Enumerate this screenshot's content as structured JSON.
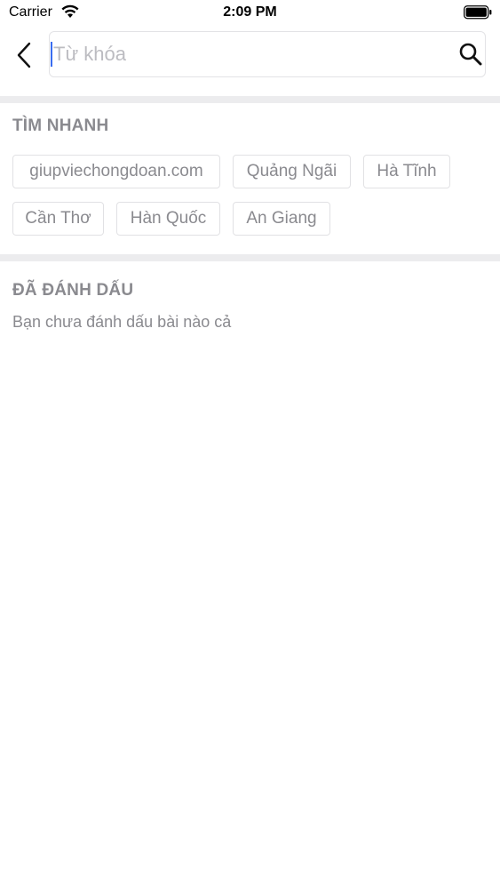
{
  "status_bar": {
    "carrier": "Carrier",
    "time": "2:09 PM"
  },
  "search": {
    "placeholder": "Từ khóa",
    "value": ""
  },
  "quick_search": {
    "title": "TÌM NHANH",
    "chips": [
      "giupviechongdoan.com",
      "Quảng Ngãi",
      "Hà Tĩnh",
      "Cần Thơ",
      "Hàn Quốc",
      "An Giang"
    ]
  },
  "bookmarks": {
    "title": "ĐÃ ĐÁNH DẤU",
    "empty_text": "Bạn chưa đánh dấu bài nào cả"
  },
  "icons": {
    "back": "chevron-left-icon",
    "search": "search-icon",
    "wifi": "wifi-icon",
    "battery": "battery-icon"
  },
  "colors": {
    "accent": "#3a6df0",
    "muted_text": "#8a8a8f",
    "divider": "#ececee"
  }
}
